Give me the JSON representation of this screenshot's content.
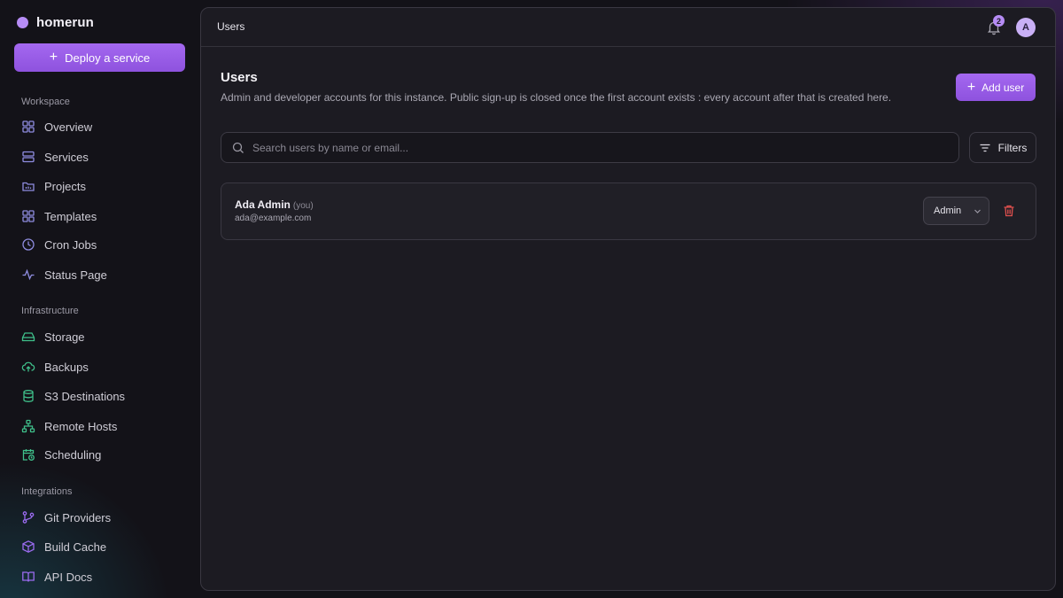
{
  "sidebar": {
    "brand": "homerun",
    "deploy_label": "Deploy a service",
    "sections": [
      {
        "label": "Workspace",
        "items": [
          {
            "label": "Overview",
            "icon": "grid-icon"
          },
          {
            "label": "Services",
            "icon": "server-icon"
          },
          {
            "label": "Projects",
            "icon": "folder-icon"
          },
          {
            "label": "Templates",
            "icon": "layout-icon"
          },
          {
            "label": "Cron Jobs",
            "icon": "clock-icon"
          },
          {
            "label": "Status Page",
            "icon": "activity-icon"
          }
        ]
      },
      {
        "label": "Infrastructure",
        "items": [
          {
            "label": "Storage",
            "icon": "hard-drive-icon"
          },
          {
            "label": "Backups",
            "icon": "cloud-upload-icon"
          },
          {
            "label": "S3 Destinations",
            "icon": "database-icon"
          },
          {
            "label": "Remote Hosts",
            "icon": "network-icon"
          },
          {
            "label": "Scheduling",
            "icon": "calendar-clock-icon"
          }
        ]
      },
      {
        "label": "Integrations",
        "items": [
          {
            "label": "Git Providers",
            "icon": "git-branch-icon"
          },
          {
            "label": "Build Cache",
            "icon": "box-icon"
          },
          {
            "label": "API Docs",
            "icon": "book-icon"
          }
        ]
      }
    ]
  },
  "topbar": {
    "title": "Users",
    "notification_count": "2",
    "avatar_initial": "A"
  },
  "page": {
    "title": "Users",
    "description": "Admin and developer accounts for this instance. Public sign-up is closed once the first account exists : every account after that is created here.",
    "add_user_label": "Add user",
    "search_placeholder": "Search users by name or email...",
    "filters_label": "Filters"
  },
  "users": [
    {
      "name": "Ada Admin",
      "you_tag": "(you)",
      "email": "ada@example.com",
      "role": "Admin"
    }
  ],
  "colors": {
    "accent": "#9b5de5",
    "background": "#131218",
    "panel": "#1c1b22",
    "infra_icon": "#3fbf8a",
    "integration_icon": "#9b6cf0",
    "workspace_icon": "#8f8de0",
    "delete": "#e0504e"
  }
}
